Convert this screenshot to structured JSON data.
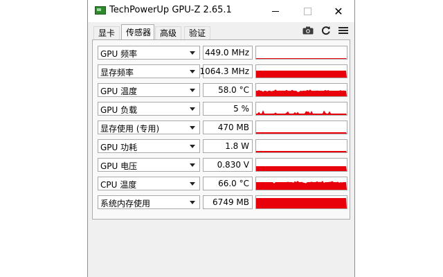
{
  "window": {
    "title": "TechPowerUp GPU-Z 2.65.1",
    "buttons": {
      "minimize": "minimize",
      "maximize": "maximize",
      "close": "✕"
    }
  },
  "tabs": [
    {
      "label": "显卡"
    },
    {
      "label": "传感器",
      "active": true
    },
    {
      "label": "高级"
    },
    {
      "label": "验证"
    }
  ],
  "toolbar_icons": [
    "camera-icon",
    "refresh-icon",
    "menu-icon"
  ],
  "colors": {
    "graph": "#e8000b",
    "panel": "#f9f9f9",
    "window": "#f0f0f0"
  },
  "sensors": [
    {
      "label": "GPU 频率",
      "value": "449.0 MHz",
      "graph_level": 0.08,
      "graph_style": "line"
    },
    {
      "label": "显存频率",
      "value": "1064.3 MHz",
      "graph_level": 0.55,
      "graph_style": "solid"
    },
    {
      "label": "GPU 温度",
      "value": "58.0 °C",
      "graph_level": 0.45,
      "graph_style": "noisy"
    },
    {
      "label": "GPU 负载",
      "value": "5 %",
      "graph_level": 0.12,
      "graph_style": "spiky"
    },
    {
      "label": "显存使用 (专用)",
      "value": "470 MB",
      "graph_level": 0.1,
      "graph_style": "line"
    },
    {
      "label": "GPU 功耗",
      "value": "1.8 W",
      "graph_level": 0.1,
      "graph_style": "line"
    },
    {
      "label": "GPU 电压",
      "value": "0.830 V",
      "graph_level": 0.4,
      "graph_style": "solid"
    },
    {
      "label": "CPU 温度",
      "value": "66.0 °C",
      "graph_level": 0.6,
      "graph_style": "noisy"
    },
    {
      "label": "系统内存使用",
      "value": "6749 MB",
      "graph_level": 0.85,
      "graph_style": "solid"
    }
  ]
}
